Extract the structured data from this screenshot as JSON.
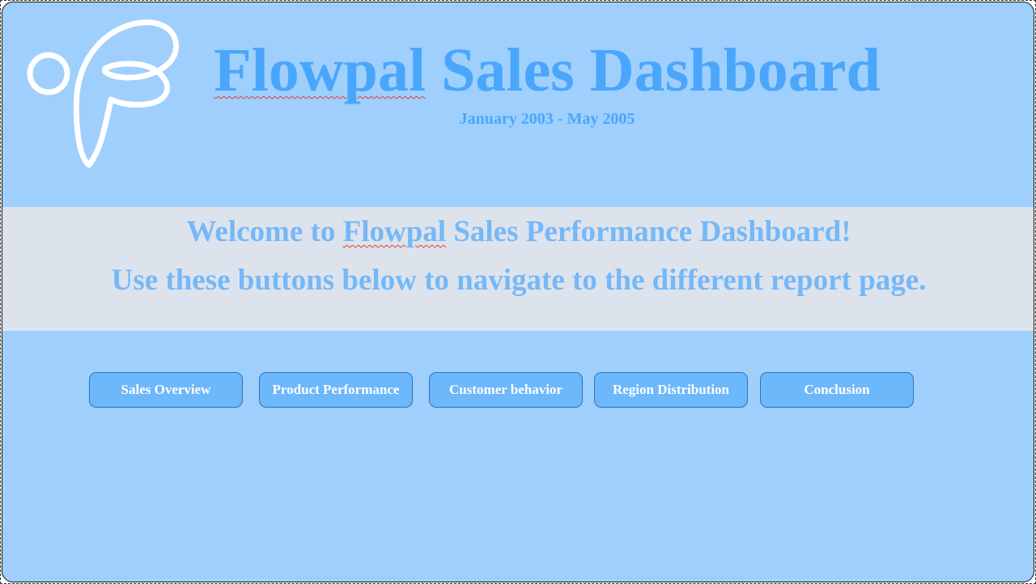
{
  "header": {
    "title_brand": "Flowpal",
    "title_rest": " Sales Dashboard",
    "date_range": "January 2003 - May 2005"
  },
  "welcome": {
    "line1_prefix": "Welcome to ",
    "line1_brand": "Flowpal",
    "line1_suffix": " Sales Performance Dashboard!",
    "line2": "Use these buttons below to navigate to the different report page."
  },
  "nav": {
    "buttons": [
      {
        "label": "Sales Overview"
      },
      {
        "label": "Product Performance"
      },
      {
        "label": "Customer behavior"
      },
      {
        "label": "Region Distribution"
      },
      {
        "label": "Conclusion"
      }
    ]
  },
  "colors": {
    "background": "#9fcffd",
    "title": "#4aa6fb",
    "band": "#dde3ec",
    "welcome_text": "#75b8f8",
    "button_fill": "#6db7fb",
    "button_border": "#2f73b8",
    "button_text": "#ffffff",
    "logo": "#ffffff"
  },
  "logo": {
    "icon": "flowpal-logo-icon"
  }
}
